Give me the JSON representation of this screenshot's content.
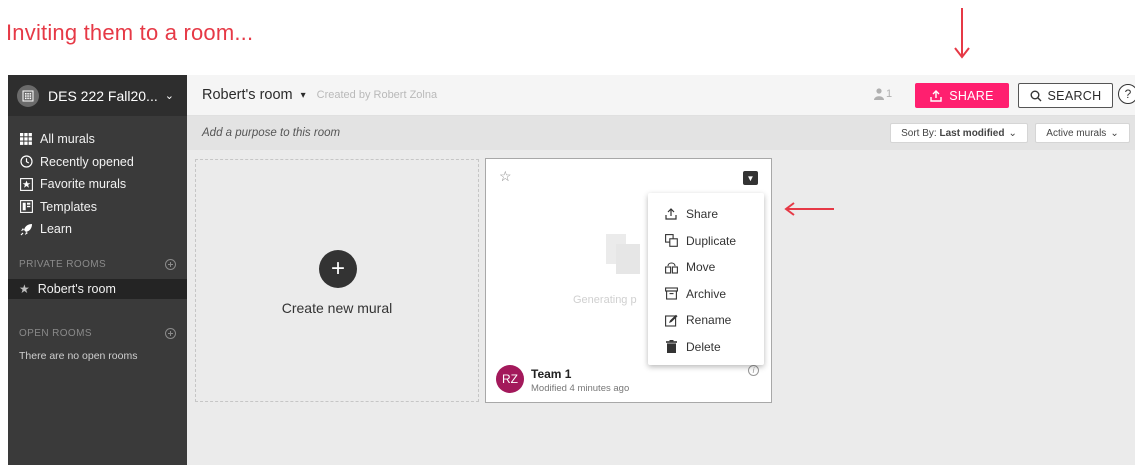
{
  "caption": "Inviting them to a room...",
  "workspace": {
    "name": "DES 222 Fall20...",
    "logo_icon": "building-icon"
  },
  "sidebar": {
    "items": [
      {
        "label": "All murals",
        "icon": "grid-icon"
      },
      {
        "label": "Recently opened",
        "icon": "clock-icon"
      },
      {
        "label": "Favorite murals",
        "icon": "star-box-icon"
      },
      {
        "label": "Templates",
        "icon": "template-icon"
      },
      {
        "label": "Learn",
        "icon": "rocket-icon"
      }
    ],
    "private_rooms_title": "PRIVATE ROOMS",
    "private_rooms": [
      {
        "label": "Robert's room"
      }
    ],
    "open_rooms_title": "OPEN ROOMS",
    "open_rooms_empty": "There are no open rooms"
  },
  "topbar": {
    "room_title": "Robert's room",
    "created_by": "Created by Robert Zolna",
    "member_count": "1",
    "share_label": "SHARE",
    "search_label": "SEARCH",
    "help_label": "?"
  },
  "purpose_bar": {
    "placeholder": "Add a purpose to this room",
    "sort_prefix": "Sort By: ",
    "sort_value": "Last modified",
    "filter_label": "Active murals"
  },
  "create_card": {
    "label": "Create new mural",
    "plus": "+"
  },
  "mural_card": {
    "generating_text": "Generating p",
    "avatar_initials": "RZ",
    "name": "Team 1",
    "meta": "Modified 4 minutes ago"
  },
  "menu": {
    "items": [
      {
        "label": "Share",
        "icon": "share-icon"
      },
      {
        "label": "Duplicate",
        "icon": "duplicate-icon"
      },
      {
        "label": "Move",
        "icon": "move-icon"
      },
      {
        "label": "Archive",
        "icon": "archive-icon"
      },
      {
        "label": "Rename",
        "icon": "rename-icon"
      },
      {
        "label": "Delete",
        "icon": "trash-icon"
      }
    ]
  },
  "colors": {
    "annotation_red": "#e63946",
    "share_pink": "#ff1f6f",
    "sidebar_bg": "#3a3a3a",
    "avatar_bg": "#a3195b"
  }
}
